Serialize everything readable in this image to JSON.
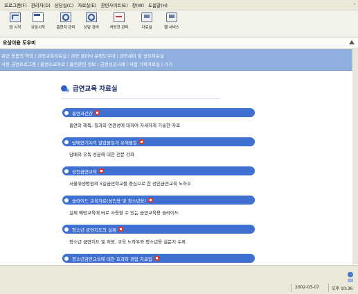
{
  "menu": {
    "items": [
      "프로그램(F)",
      "관리자(D)",
      "상담실(C)",
      "자료실(E)",
      "관련사이트(E)",
      "창(W)",
      "도움말(H)"
    ],
    "minimize": "-"
  },
  "toolbar": {
    "buttons": [
      {
        "label": "금 시작",
        "icon": "start-icon"
      },
      {
        "label": "상담시작",
        "icon": "consult-start-icon"
      },
      {
        "label": "흡연자 관리",
        "icon": "smoker-search-icon"
      },
      {
        "label": "상담 관리",
        "icon": "consult-search-icon"
      },
      {
        "label": "처방전 관리",
        "icon": "prescription-icon"
      },
      {
        "label": "자료실",
        "icon": "library-icon"
      },
      {
        "label": "웹 서비스",
        "icon": "web-service-icon"
      }
    ]
  },
  "breadcrumb": {
    "label": "요상이용 도우미"
  },
  "nav": {
    "line1": "관련 용품의 역학 | 금연교육자료실 | 금연 클리닉 운영도우미 | 금연세미 및 성모자료실",
    "line2": "사용 금연프로그램 | 흡연소요자료 | 흡연관련 정보 | 금연성공사례 | 사업 기획자료실 | 가기"
  },
  "page": {
    "title": "금연교육 자료실",
    "items": [
      {
        "name": "흡연과건강",
        "desc": "흡연의 해독, 질과의 연관성에 대하여 자세하게 기술한 자료"
      },
      {
        "name": "담배연기속의 발암물질과 유해물질",
        "desc": "담배의 유독 성분에 대한 전문 강좌"
      },
      {
        "name": "성인금연교육",
        "desc": "서울위생병원의 5일금연학교를 중심으로 한 성인금연교육 노하우"
      },
      {
        "name": "슬라이드 교육자료(성인용 및 청소년용)",
        "desc": "실제 예방교육에 바로 사용할 수 있는 금연교육용 슬라이드"
      },
      {
        "name": "청소년 금연지도의 실제",
        "desc": "청소년 금연지도 및 처방, 교육 노하우와 청소년용 설문지 수록"
      },
      {
        "name": "청소년금연교육에 대한 효과와 경험 자료집",
        "desc": ""
      }
    ]
  },
  "status": {
    "date": "2002-03-07",
    "time": "오후 10:36"
  },
  "colors": {
    "accent": "#3f6fd0",
    "nav_band": "#8fb0de",
    "new_badge": "#e03a2a"
  }
}
